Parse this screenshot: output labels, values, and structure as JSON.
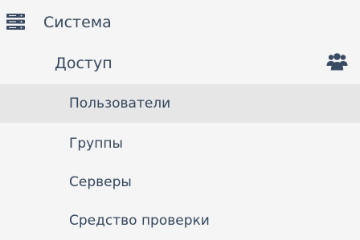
{
  "nav": {
    "section": {
      "label": "Система",
      "icon": "server-icon"
    },
    "group": {
      "label": "Доступ",
      "icon": "users-icon"
    },
    "items": [
      {
        "label": "Пользователи",
        "active": true
      },
      {
        "label": "Группы",
        "active": false
      },
      {
        "label": "Серверы",
        "active": false
      },
      {
        "label": "Средство проверки",
        "active": false
      }
    ]
  },
  "colors": {
    "background": "#f5f5f5",
    "active_background": "#e6e6e6",
    "text": "#34475e",
    "icon": "#3a4b63"
  }
}
